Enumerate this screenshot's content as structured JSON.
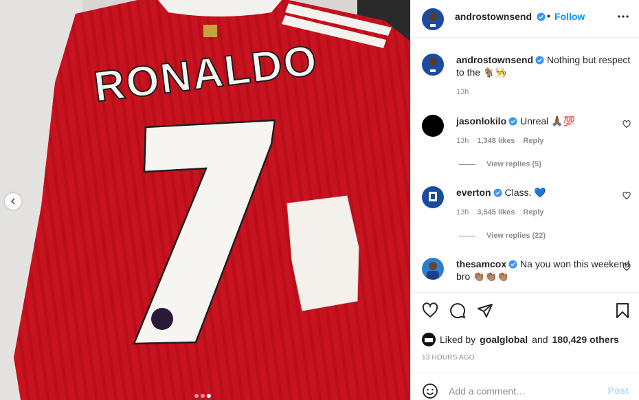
{
  "post": {
    "username": "androstownsend",
    "follow_label": "Follow",
    "separator": "•",
    "caption": "Nothing but respect to the 🐐👨‍🍳",
    "caption_time": "13h"
  },
  "photo": {
    "jersey_name": "RONALDO",
    "jersey_number": "7",
    "carousel_dots": 3,
    "active_dot": 3
  },
  "comments": [
    {
      "username": "jasonlokilo",
      "text": "Unreal 🙏🏾💯",
      "time": "13h",
      "likes": "1,348 likes",
      "reply_label": "Reply",
      "view_replies": "View replies (5)"
    },
    {
      "username": "everton",
      "text": "Class. 💙",
      "time": "13h",
      "likes": "3,545 likes",
      "reply_label": "Reply",
      "view_replies": "View replies (22)"
    },
    {
      "username": "thesamcox",
      "text": "Na you won this weekend bro 👏🏽👏🏽👏🏽"
    }
  ],
  "likes": {
    "prefix": "Liked by",
    "liker": "goalglobal",
    "and": "and",
    "others": "180,429 others"
  },
  "timestamp": "13 HOURS AGO",
  "add_comment": {
    "placeholder": "Add a comment…",
    "post_label": "Post"
  },
  "colors": {
    "accent": "#0095f6",
    "post_disabled": "#b2dffc",
    "verified": "#3897f0",
    "jersey_red": "#c8102e",
    "everton_blue": "#1b4aa1"
  },
  "icons": {
    "verified": "verified-badge-icon",
    "more": "more-dots-icon",
    "heart": "heart-icon",
    "comment": "comment-bubble-icon",
    "share": "paper-plane-icon",
    "save": "bookmark-icon",
    "emoji": "smiley-icon",
    "prev": "chevron-left-icon"
  }
}
